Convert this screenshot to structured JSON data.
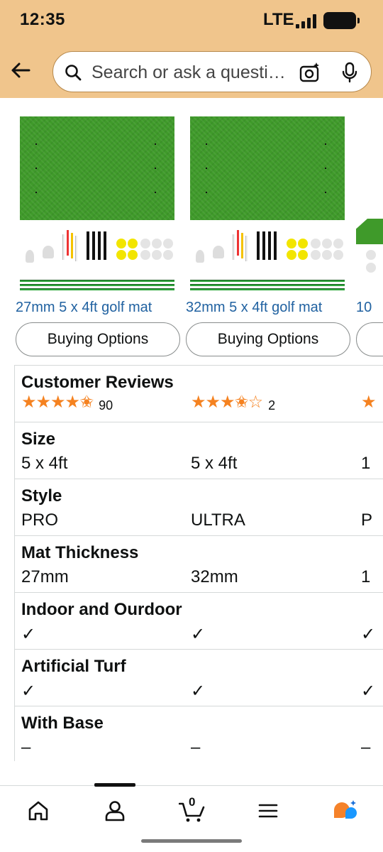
{
  "status_bar": {
    "time": "12:35",
    "network": "LTE"
  },
  "search": {
    "placeholder": "Search or ask a question"
  },
  "products": [
    {
      "title": "27mm 5 x 4ft golf mat",
      "button": "Buying Options"
    },
    {
      "title": "32mm 5 x 4ft golf mat",
      "button": "Buying Options"
    },
    {
      "title": "10",
      "button": ""
    }
  ],
  "compare": {
    "reviews": {
      "label": "Customer Reviews",
      "items": [
        {
          "rating": 4.5,
          "stars": "★★★★✬",
          "count": "90"
        },
        {
          "rating": 3.5,
          "stars": "★★★✬☆",
          "count": "2"
        },
        {
          "stars": "★",
          "count": ""
        }
      ]
    },
    "rows": [
      {
        "label": "Size",
        "values": [
          "5 x 4ft",
          "5 x 4ft",
          "1"
        ]
      },
      {
        "label": "Style",
        "values": [
          "PRO",
          "ULTRA",
          "P"
        ]
      },
      {
        "label": "Mat Thickness",
        "values": [
          "27mm",
          "32mm",
          "1"
        ]
      },
      {
        "label": "Indoor and Ourdoor",
        "values": [
          "✓",
          "✓",
          "✓"
        ]
      },
      {
        "label": "Artificial Turf",
        "values": [
          "✓",
          "✓",
          "✓"
        ]
      },
      {
        "label": "With Base",
        "values": [
          "–",
          "–",
          "–"
        ]
      }
    ]
  },
  "bottom_nav": {
    "items": [
      "home-icon",
      "account-icon",
      "cart-icon",
      "menu-icon",
      "rufus-icon"
    ],
    "cart_count": "0",
    "active": "account-icon"
  },
  "colors": {
    "header": "#f0c58c",
    "link": "#2162a1",
    "star": "#f58220",
    "turf": "#3f9a2a"
  }
}
